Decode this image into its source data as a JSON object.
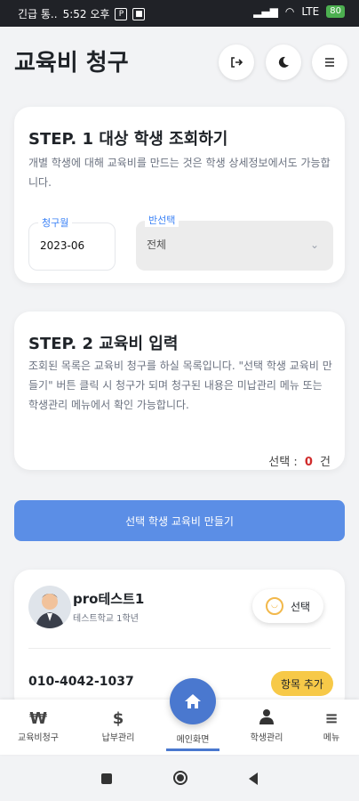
{
  "status": {
    "left_text": "긴급 통..",
    "time": "5:52 오후",
    "right_text": "LTE",
    "battery": "80"
  },
  "header": {
    "title": "교육비 청구",
    "logout_icon": "logout-icon",
    "theme_icon": "moon-icon",
    "menu_icon": "hamburger-icon"
  },
  "step1": {
    "title": "STEP. 1 대상 학생 조회하기",
    "description": "개별 학생에 대해 교육비를 만드는 것은 학생 상세정보에서도 가능합니다.",
    "month_label": "청구월",
    "month_value": "2023-06",
    "class_label": "반선택",
    "class_value": "전체"
  },
  "step2": {
    "title": "STEP. 2 교육비 입력",
    "description": "조회된 목록은 교육비 청구를 하실 목록입니다. \"선택 학생 교육비 만들기\" 버튼 클릭 시 청구가 되며 청구된 내용은 미납관리 메뉴 또는 학생관리 메뉴에서 확인 가능합니다.",
    "selected_label": "선택 :",
    "selected_count": "0",
    "selected_unit": "건"
  },
  "cta_label": "선택 학생 교육비 만들기",
  "student": {
    "name": "pro테스트1",
    "school": "테스트학교 1학년",
    "select_label": "선택",
    "phone": "010-4042-1037",
    "add_item_label": "항목 추가"
  },
  "nav": {
    "items": [
      {
        "label": "교육비청구",
        "glyph": "₩"
      },
      {
        "label": "납부관리",
        "glyph": "$"
      },
      {
        "label": "메인화면",
        "glyph": ""
      },
      {
        "label": "학생관리",
        "glyph": ""
      },
      {
        "label": "메뉴",
        "glyph": "≡"
      }
    ]
  },
  "colors": {
    "accent": "#4a78cf",
    "cta": "#5b8ee6",
    "badge": "#f7c948",
    "count_red": "#d02b2b"
  }
}
